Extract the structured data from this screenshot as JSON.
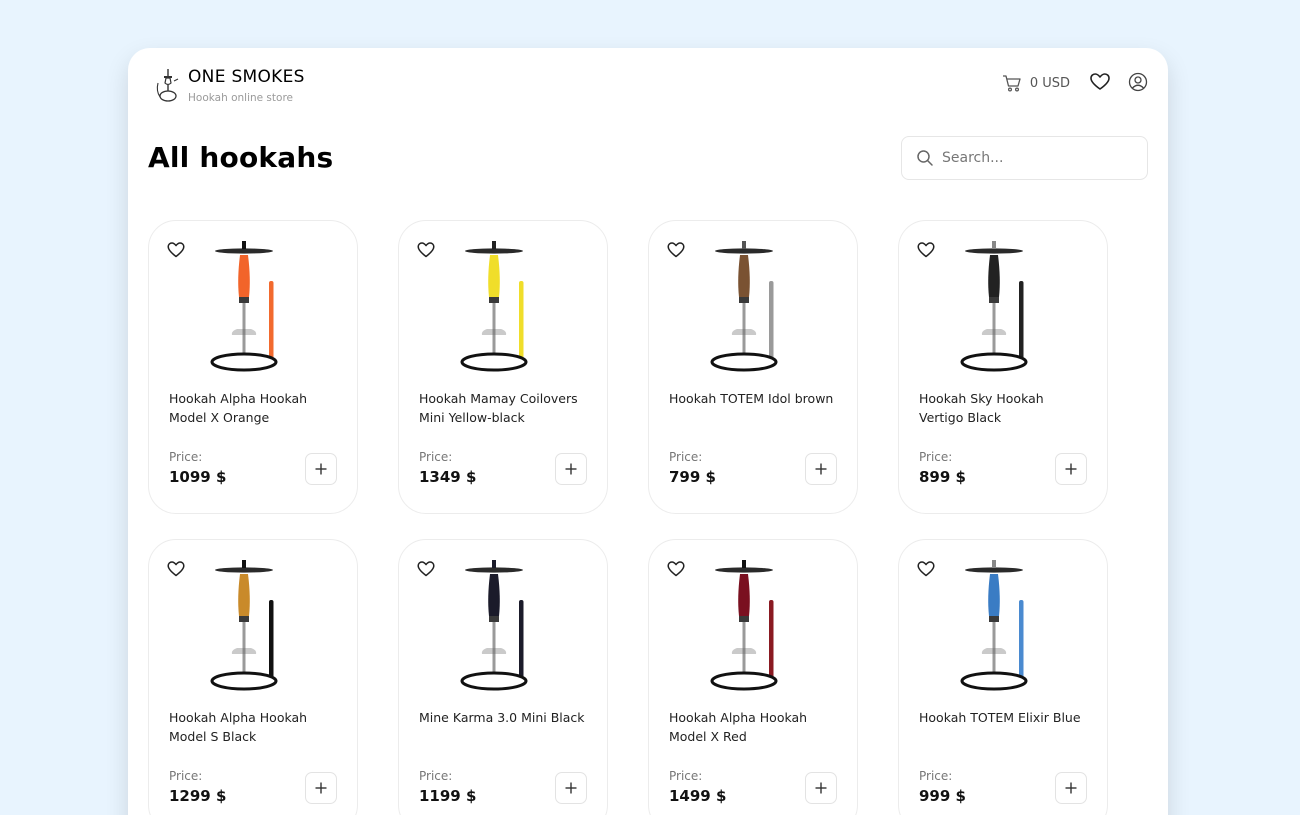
{
  "header": {
    "brand_title": "ONE SMOKES",
    "brand_subtitle": "Hookah online store",
    "cart_total": "0 USD",
    "icons": [
      "hookah-logo-icon",
      "cart-icon",
      "heart-icon",
      "user-icon"
    ]
  },
  "main": {
    "title": "All hookahs",
    "search_placeholder": "Search...",
    "price_label": "Price:"
  },
  "products": [
    {
      "name": "Hookah Alpha Hookah Model X Orange",
      "price": "1099 $",
      "colors": {
        "shaft": "#f2642a",
        "hose": "#f26a2e",
        "base": "#111111"
      }
    },
    {
      "name": "Hookah Mamay Coilovers Mini Yellow-black",
      "price": "1349 $",
      "colors": {
        "shaft": "#f0de2a",
        "hose": "#f0de2a",
        "base": "#222222"
      }
    },
    {
      "name": "Hookah TOTEM Idol brown",
      "price": "799 $",
      "colors": {
        "shaft": "#7a5232",
        "hose": "#9a9a9a",
        "base": "#555555"
      }
    },
    {
      "name": "Hookah Sky Hookah Vertigo Black",
      "price": "899 $",
      "colors": {
        "shaft": "#222222",
        "hose": "#222222",
        "base": "#888888"
      }
    },
    {
      "name": "Hookah Alpha Hookah Model S Black",
      "price": "1299 $",
      "colors": {
        "shaft": "#c98a2a",
        "hose": "#111111",
        "base": "#111111"
      }
    },
    {
      "name": "Mine Karma 3.0 Mini Black",
      "price": "1199 $",
      "colors": {
        "shaft": "#1b1b2a",
        "hose": "#1b1b2a",
        "base": "#1b1b2a"
      }
    },
    {
      "name": "Hookah Alpha Hookah Model X Red",
      "price": "1499 $",
      "colors": {
        "shaft": "#7a1020",
        "hose": "#8a1a22",
        "base": "#111111"
      }
    },
    {
      "name": "Hookah TOTEM Elixir Blue",
      "price": "999 $",
      "colors": {
        "shaft": "#3a7cc4",
        "hose": "#4a8ad0",
        "base": "#888888"
      }
    }
  ]
}
